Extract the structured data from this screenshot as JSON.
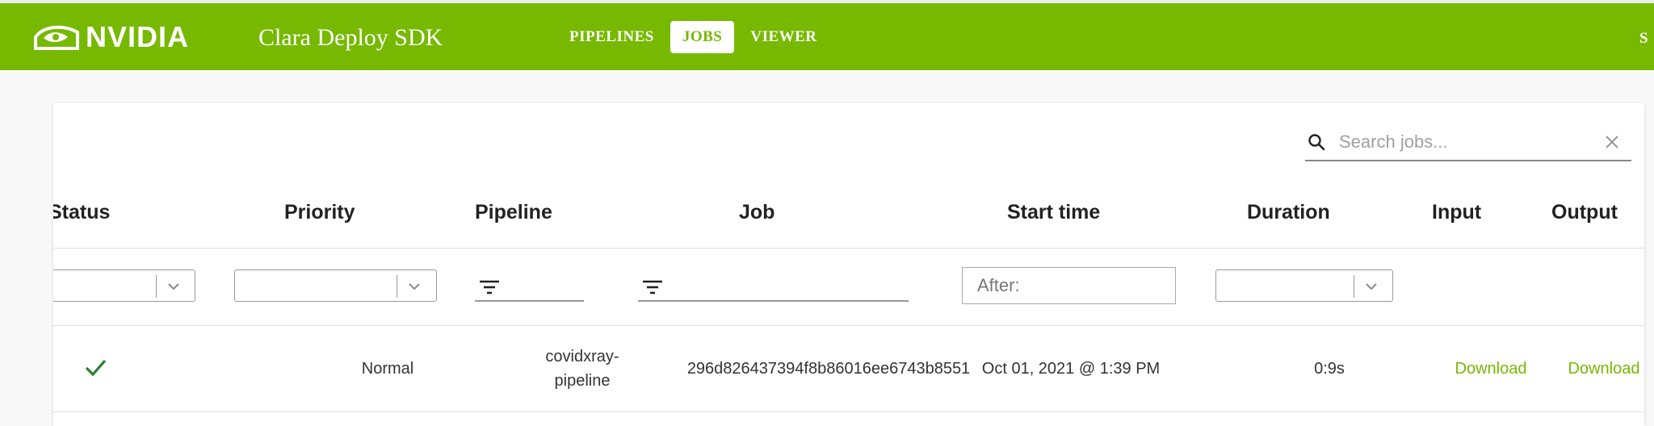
{
  "header": {
    "logo_text": "NVIDIA",
    "app_title": "Clara Deploy SDK",
    "nav": [
      {
        "label": "PIPELINES",
        "active": false
      },
      {
        "label": "JOBS",
        "active": true
      },
      {
        "label": "VIEWER",
        "active": false
      }
    ],
    "right_text": "S"
  },
  "search": {
    "placeholder": "Search jobs...",
    "value": ""
  },
  "columns": [
    "Status",
    "Priority",
    "Pipeline",
    "Job",
    "Start time",
    "Duration",
    "Input",
    "Output"
  ],
  "filters": {
    "status_value": "",
    "priority_value": "",
    "pipeline_value": "",
    "job_value": "",
    "start_time_placeholder": "After:",
    "duration_value": ""
  },
  "rows": [
    {
      "status_icon": "check-icon",
      "priority": "Normal",
      "pipeline_line1": "covidxray-",
      "pipeline_line2": "pipeline",
      "job": "296d826437394f8b86016ee6743b8551",
      "start_time": "Oct 01, 2021 @ 1:39 PM",
      "duration": "0:9s",
      "input": "Download",
      "output": "Download"
    }
  ],
  "colors": {
    "brand": "#76b900",
    "status_ok": "#2e7d32"
  }
}
